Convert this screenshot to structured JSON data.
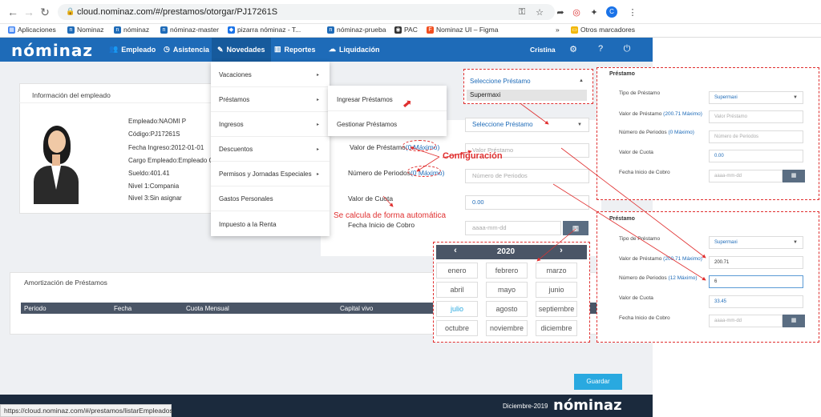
{
  "browser": {
    "url": "cloud.nominaz.com/#/prestamos/otorgar/PJ17261S",
    "profile_initial": "C",
    "bookmarks": [
      "Aplicaciones",
      "Nominaz",
      "nóminaz",
      "nóminaz-master",
      "pizarra nóminaz - T...",
      "nóminaz-prueba",
      "PAC",
      "Nominaz UI – Figma"
    ],
    "bookmarks_more": "»",
    "other_bookmarks": "Otros marcadores",
    "status_url": "https://cloud.nominaz.com/#/prestamos/listarEmpleados"
  },
  "app": {
    "logo": "nóminaz",
    "nav": [
      "Empleado",
      "Asistencia",
      "Novedades",
      "Reportes",
      "Liquidación"
    ],
    "user": "Cristina"
  },
  "employee": {
    "title": "Información del empleado",
    "lines": [
      {
        "k": "Empleado:",
        "v": "NAOMI P"
      },
      {
        "k": "Código:",
        "v": "PJ17261S"
      },
      {
        "k": "Fecha Ingreso:",
        "v": "2012-01-01"
      },
      {
        "k": "Cargo Empleado:",
        "v": "Empleado G"
      },
      {
        "k": "Sueldo:",
        "v": "401.41"
      },
      {
        "k": "Nivel 1:",
        "v": "Compania"
      },
      {
        "k": "Nivel 3:",
        "v": "Sin asignar"
      }
    ]
  },
  "menu": {
    "items": [
      "Vacaciones",
      "Préstamos",
      "Ingresos",
      "Descuentos",
      "Permisos y Jornadas Especiales",
      "Gastos Personales",
      "Impuesto a la Renta"
    ],
    "submenu": [
      "Ingresar Préstamos",
      "Gestionar Préstamos"
    ]
  },
  "form": {
    "select_placeholder": "Seleccione Préstamo",
    "monto_label": "Valor de Préstamo",
    "monto_hint": "(0 Máximo)",
    "monto_placeholder": "Valor Préstamo",
    "periodos_label": "Número de Periodos",
    "periodos_hint": "(0 Máximo)",
    "periodos_placeholder": "Número de Periodos",
    "cuota_label": "Valor de Cuota",
    "cuota_value": "0.00",
    "fecha_label": "Fecha Inicio de Cobro",
    "fecha_placeholder": "aaaa-mm-dd",
    "dropdown_open": {
      "placeholder": "Seleccione Préstamo",
      "option": "Supermaxi"
    }
  },
  "annotations": {
    "config": "Configuración",
    "auto": "Se calcula de forma automática"
  },
  "calendar": {
    "year": "2020",
    "months": [
      "enero",
      "febrero",
      "marzo",
      "abril",
      "mayo",
      "junio",
      "julio",
      "agosto",
      "septiembre",
      "octubre",
      "noviembre",
      "diciembre"
    ],
    "current_month": "julio"
  },
  "amortization": {
    "title": "Amortización de Préstamos",
    "columns": [
      "Periodo",
      "Fecha",
      "Cuota Mensual",
      "Capital vivo"
    ]
  },
  "actions": {
    "save": "Guardar"
  },
  "footer": {
    "date": "Diciembre-2019",
    "logo": "nóminaz"
  },
  "panel1": {
    "title": "Préstamo",
    "tipo_label": "Tipo de Préstamo",
    "tipo_value": "Supermaxi",
    "monto_label": "Valor de Préstamo",
    "monto_hint": "(200.71 Máximo)",
    "monto_placeholder": "Valor Préstamo",
    "periodos_label": "Número de Periodos",
    "periodos_hint": "(0 Máximo)",
    "periodos_placeholder": "Número de Periodos",
    "cuota_label": "Valor de Cuota",
    "cuota_value": "0.00",
    "fecha_label": "Fecha Inicio de Cobro",
    "fecha_placeholder": "aaaa-mm-dd"
  },
  "panel2": {
    "title": "Préstamo",
    "tipo_label": "Tipo de Préstamo",
    "tipo_value": "Supermaxi",
    "monto_label": "Valor de Préstamo",
    "monto_hint": "(200.71 Máximo)",
    "monto_value": "200.71",
    "periodos_label": "Número de Periodos",
    "periodos_hint": "(12 Máximo)",
    "periodos_value": "6",
    "cuota_label": "Valor de Cuota",
    "cuota_value": "33.45",
    "fecha_label": "Fecha Inicio de Cobro",
    "fecha_placeholder": "aaaa-mm-dd"
  },
  "colors": {
    "primary": "#1e6bb8",
    "accent": "#29a9e0",
    "annotation": "#e03030",
    "footer": "#1b2a3d"
  }
}
